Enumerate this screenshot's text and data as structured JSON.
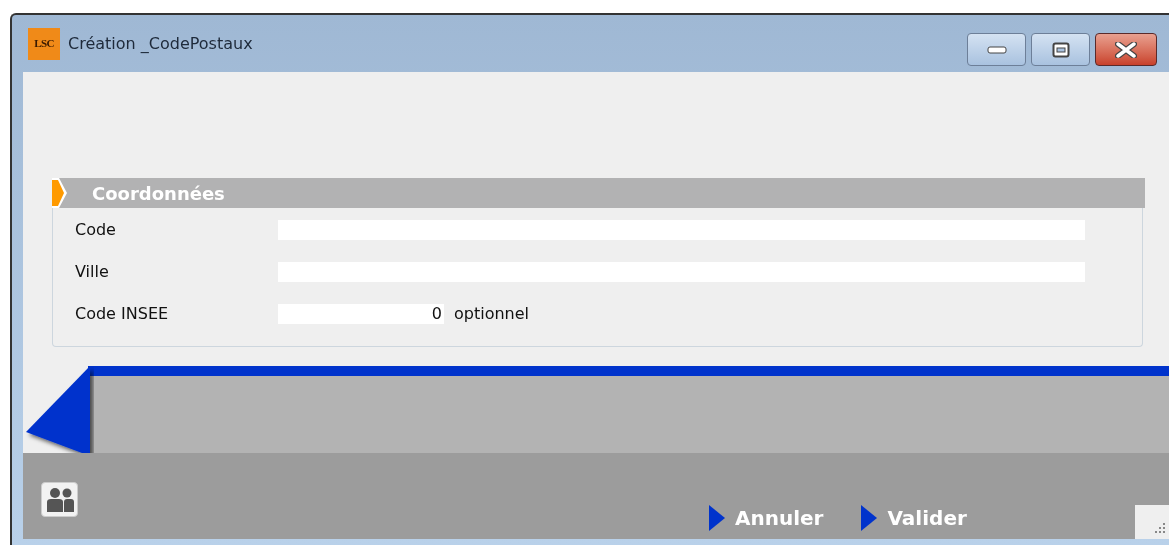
{
  "window": {
    "title": "Création _CodePostaux",
    "app_icon_text": "LSC"
  },
  "section": {
    "title": "Coordonnées"
  },
  "fields": [
    {
      "label": "Code",
      "kind": "wide"
    },
    {
      "label": "Ville",
      "kind": "wide"
    },
    {
      "label": "Code INSEE",
      "value": "0",
      "kind": "number",
      "hint": "optionnel"
    }
  ],
  "buttons": [
    {
      "label": "Annuler"
    },
    {
      "label": "Valider"
    }
  ]
}
